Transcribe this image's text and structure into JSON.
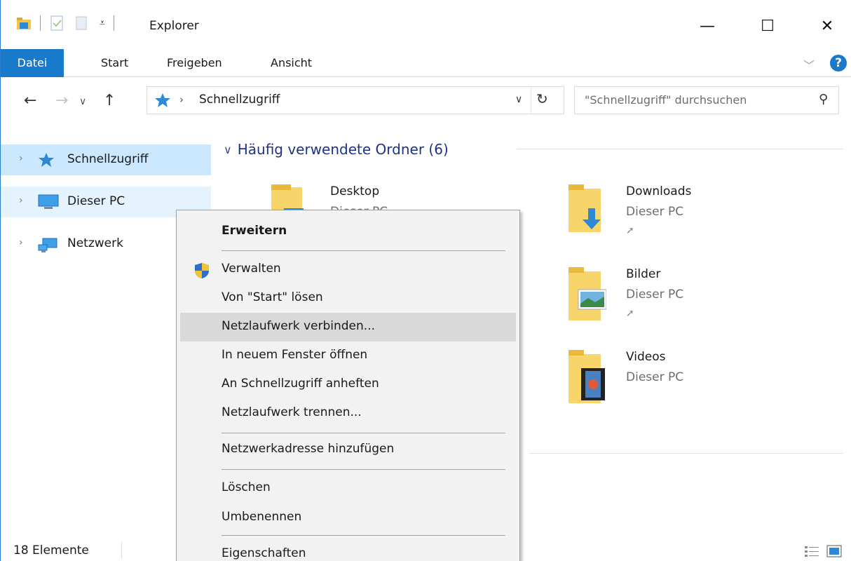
{
  "window": {
    "title": "Explorer",
    "controls": {
      "minimize": "—",
      "maximize": "☐",
      "close": "✕"
    }
  },
  "ribbon": {
    "tabs": [
      {
        "label": "Datei",
        "active": true
      },
      {
        "label": "Start"
      },
      {
        "label": "Freigeben"
      },
      {
        "label": "Ansicht"
      }
    ],
    "help": "?",
    "collapse_chevron": "﹀"
  },
  "navigation": {
    "address_crumb": "Schnellzugriff",
    "search_placeholder": "\"Schnellzugriff\" durchsuchen"
  },
  "nav_pane": {
    "items": [
      {
        "label": "Schnellzugriff",
        "icon": "star-icon",
        "state": "selected"
      },
      {
        "label": "Dieser PC",
        "icon": "computer-icon",
        "state": "hover"
      },
      {
        "label": "Netzwerk",
        "icon": "network-icon",
        "state": "normal"
      }
    ]
  },
  "content": {
    "group_title": "Häufig verwendete Ordner (6)",
    "folders": [
      {
        "name": "Desktop",
        "location": "Dieser PC"
      },
      {
        "name": "Downloads",
        "location": "Dieser PC",
        "pinned": true
      },
      {
        "name": "Bilder",
        "location": "Dieser PC",
        "pinned": true
      },
      {
        "name": "Videos",
        "location": "Dieser PC"
      }
    ]
  },
  "context_menu": {
    "items": [
      {
        "label": "Erweitern",
        "bold": true
      },
      {
        "label": "Verwalten",
        "icon": "shield-icon"
      },
      {
        "label": "Von \"Start\" lösen"
      },
      {
        "label": "Netzlaufwerk verbinden...",
        "highlighted": true
      },
      {
        "label": "In neuem Fenster öffnen"
      },
      {
        "label": "An Schnellzugriff anheften"
      },
      {
        "label": "Netzlaufwerk trennen..."
      },
      {
        "label": "Netzwerkadresse hinzufügen"
      },
      {
        "label": "Löschen"
      },
      {
        "label": "Umbenennen"
      },
      {
        "label": "Eigenschaften"
      }
    ]
  },
  "status_bar": {
    "item_count": "18 Elemente"
  },
  "colors": {
    "accent": "#1979ca",
    "selection": "#cce8ff",
    "hover": "#e5f3ff",
    "group_header": "#1e3287",
    "menu_bg": "#f2f2f2",
    "menu_highlight": "#d9d9d9"
  }
}
